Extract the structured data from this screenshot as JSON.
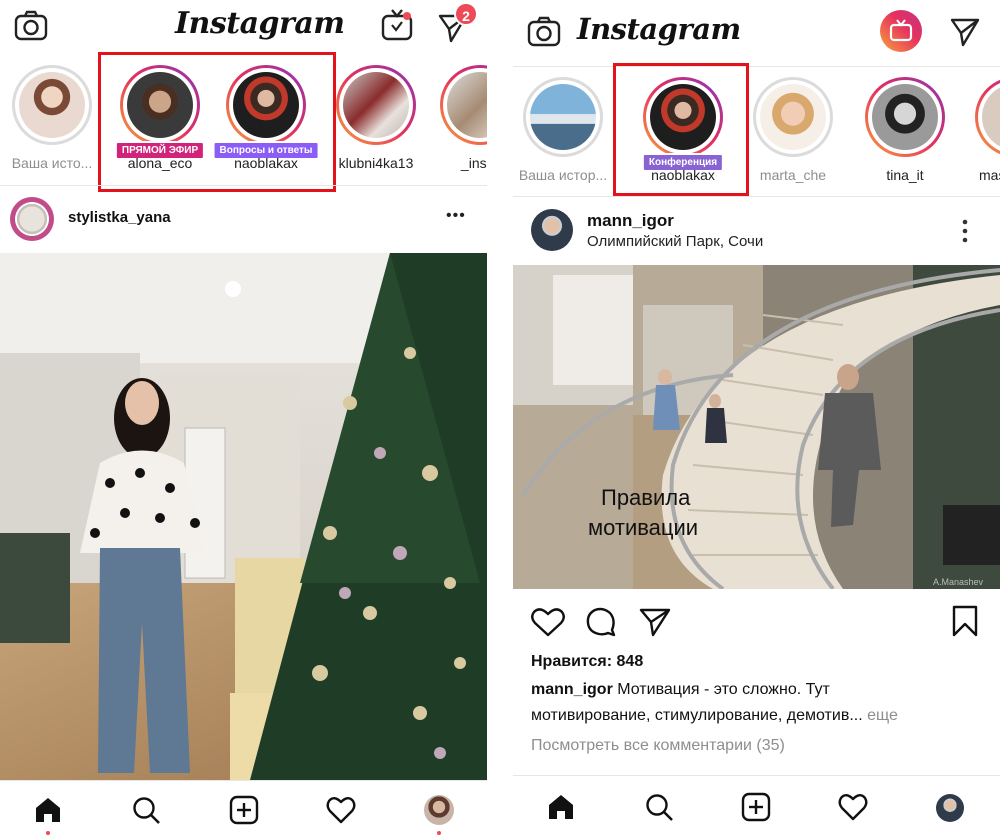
{
  "left": {
    "app_title": "Instagram",
    "dm_badge": "2",
    "stories": [
      {
        "label": "Ваша исто...",
        "badge": ""
      },
      {
        "label": "alona_eco",
        "badge": "ПРЯМОЙ ЭФИР"
      },
      {
        "label": "naoblakax",
        "badge": "Вопросы и ответы"
      },
      {
        "label": "klubni4ka13",
        "badge": ""
      },
      {
        "label": "_inser",
        "badge": ""
      }
    ],
    "post": {
      "username": "stylistka_yana",
      "menu": "•••"
    }
  },
  "right": {
    "app_title": "Instagram",
    "stories": [
      {
        "label": "Ваша истор...",
        "badge": ""
      },
      {
        "label": "naoblakax",
        "badge": "Конференция"
      },
      {
        "label": "marta_che",
        "badge": ""
      },
      {
        "label": "tina_it",
        "badge": ""
      },
      {
        "label": "mash",
        "badge": ""
      }
    ],
    "post": {
      "username": "mann_igor",
      "location": "Олимпийский Парк, Сочи",
      "image_caption_line1": "Правила",
      "image_caption_line2": "мотивации",
      "watermark": "A.Manashev",
      "likes": "Нравится: 848",
      "caption_user": "mann_igor",
      "caption_text": " Мотивация - это сложно. Тут",
      "caption_line2": "мотивирование, стимулирование, демотив...",
      "caption_more": " еще",
      "comments_link": "Посмотреть все комментарии (35)"
    }
  },
  "colors": {
    "highlight_box": "#e3121b",
    "live_badge": "#d1237a",
    "qa_badge": "#8b5cf6",
    "conf_badge": "#8a63d2",
    "like_dot": "#ed4956"
  }
}
